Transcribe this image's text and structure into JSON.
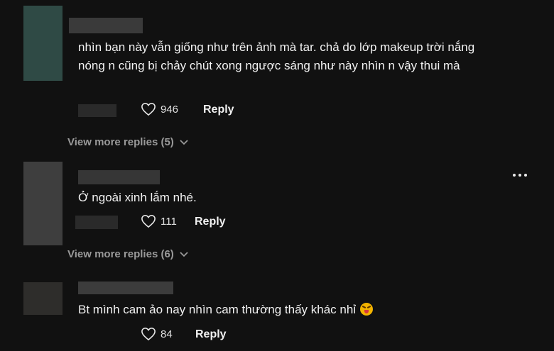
{
  "comments": [
    {
      "text": "nhìn bạn này vẫn giống như trên ảnh mà tar. chả do lớp makeup trời nắng nóng n cũng bị chảy chút xong ngược sáng như này nhìn n vậy thui mà",
      "likes": "946",
      "reply_label": "Reply",
      "view_more": "View more replies (5)"
    },
    {
      "text": "Ở ngoài xinh lắm nhé.",
      "likes": "111",
      "reply_label": "Reply",
      "view_more": "View more replies (6)"
    },
    {
      "text": "Bt mình cam ảo nay nhìn cam thường thấy khác nhỉ",
      "likes": "84",
      "reply_label": "Reply",
      "emoji": "squinting-tongue-emoji"
    }
  ],
  "icons": {
    "heart": "heart-outline-icon",
    "chevron": "chevron-down-icon",
    "more": "more-dots-icon"
  },
  "colors": {
    "background": "#111111",
    "text": "#f2f2f2",
    "muted": "#9a9a9a"
  }
}
